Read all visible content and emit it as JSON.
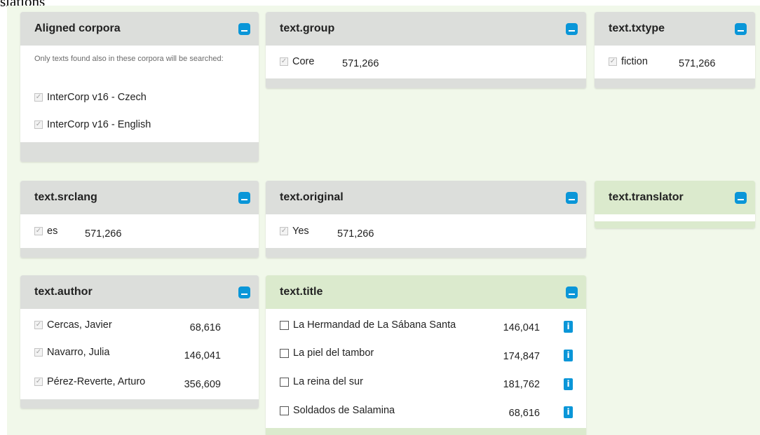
{
  "top_fragment": "slations",
  "aligned": {
    "title": "Aligned corpora",
    "hint": "Only texts found also in these corpora will be searched:",
    "items": [
      {
        "label": "InterCorp v16 - Czech"
      },
      {
        "label": "InterCorp v16 - English"
      }
    ]
  },
  "group": {
    "title": "text.group",
    "items": [
      {
        "label": "Core",
        "count": "571,266"
      }
    ]
  },
  "txtype": {
    "title": "text.txtype",
    "items": [
      {
        "label": "fiction",
        "count": "571,266"
      }
    ]
  },
  "srclang": {
    "title": "text.srclang",
    "items": [
      {
        "label": "es",
        "count": "571,266"
      }
    ]
  },
  "original": {
    "title": "text.original",
    "items": [
      {
        "label": "Yes",
        "count": "571,266"
      }
    ]
  },
  "translator": {
    "title": "text.translator"
  },
  "author": {
    "title": "text.author",
    "items": [
      {
        "label": "Cercas, Javier",
        "count": "68,616"
      },
      {
        "label": "Navarro, Julia",
        "count": "146,041"
      },
      {
        "label": "Pérez-Reverte, Arturo",
        "count": "356,609"
      }
    ]
  },
  "title_panel": {
    "title": "text.title",
    "items": [
      {
        "label": "La Hermandad de La Sábana Santa",
        "count": "146,041",
        "info": "i"
      },
      {
        "label": "La piel del tambor",
        "count": "174,847",
        "info": "i"
      },
      {
        "label": "La reina del sur",
        "count": "181,762",
        "info": "i"
      },
      {
        "label": "Soldados de Salamina",
        "count": "68,616",
        "info": "i"
      }
    ]
  },
  "checkmark_glyph": "✓",
  "colors": {
    "background": "#f1f8ea",
    "header_gray": "#dcdedb",
    "header_active_green": "#dbeacd",
    "accent_blue": "#0a96d8"
  }
}
